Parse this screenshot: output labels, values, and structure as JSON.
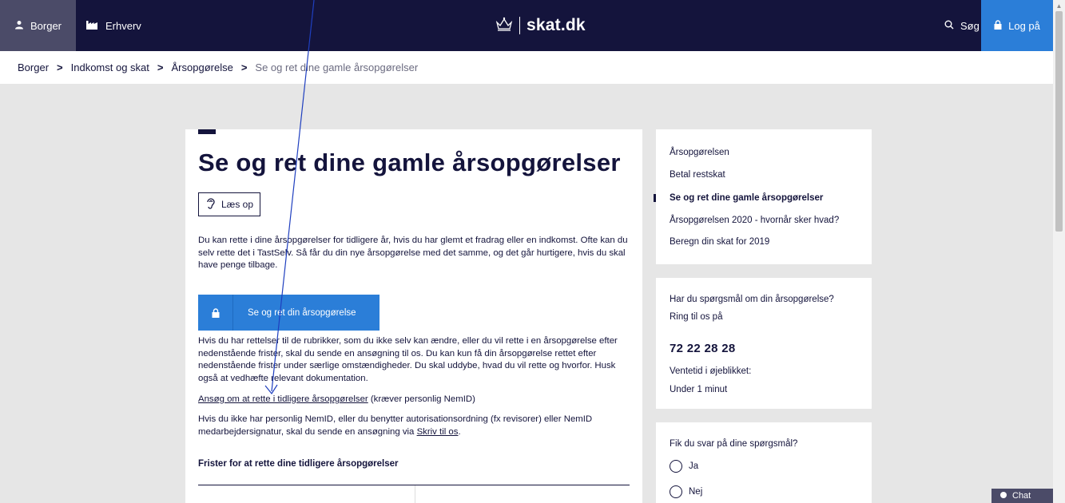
{
  "header": {
    "tab_borger": "Borger",
    "tab_erhverv": "Erhverv",
    "logo_text": "skat.dk",
    "search_label": "Søg",
    "login_label": "Log på",
    "colors": {
      "topbar": "#14143c",
      "active_tab": "#4b4b68",
      "login": "#2b7ed8"
    }
  },
  "breadcrumb": {
    "items": [
      "Borger",
      "Indkomst og skat",
      "Årsopgørelse"
    ],
    "current": "Se og ret dine gamle årsopgørelser",
    "separator": ">"
  },
  "main": {
    "title": "Se og ret dine gamle årsopgørelser",
    "read_aloud_label": "Læs op",
    "intro": "Du kan rette i dine årsopgørelser for tidligere år, hvis du har glemt et fradrag eller en indkomst. Ofte kan du selv rette det i TastSelv. Så får du din nye årsopgørelse med det samme, og det går hurtigere, hvis du skal have penge tilbage.",
    "cta_label": "Se og ret din årsopgørelse",
    "body": "Hvis du har rettelser til de rubrikker, som du ikke selv kan ændre, eller du vil rette i en årsopgørelse efter nedenstående frister, skal du sende en ansøgning til os. Du kan kun få din årsopgørelse rettet efter nedenstående frister under særlige omstændigheder. Du skal uddybe, hvad du vil rette og hvorfor. Husk også at vedhæfte relevant dokumentation.",
    "apply_link": "Ansøg om at rette i tidligere årsopgørelser",
    "apply_note": " (kræver personlig NemID)",
    "nemid_text": "Hvis du ikke har personlig NemID, eller du benytter autorisationsordning (fx revisorer) eller NemID medarbejdersignatur, skal du sende en ansøgning via ",
    "write_link": "Skriv til os",
    "write_suffix": ".",
    "deadlines_heading": "Frister for at rette dine tidligere årsopgørelser"
  },
  "sidebar_nav": {
    "items": [
      "Årsopgørelsen",
      "Betal restskat",
      "Se og ret dine gamle årsopgørelser",
      "Årsopgørelsen 2020 - hvornår sker hvad?",
      "Beregn din skat for 2019"
    ],
    "active_index": 2
  },
  "contact": {
    "question": "Har du spørgsmål om din årsopgørelse?",
    "call": "Ring til os på",
    "phone": "72 22 28 28",
    "wait_label": "Ventetid i øjeblikket:",
    "wait_value": "Under 1 minut"
  },
  "feedback": {
    "question": "Fik du svar på dine spørgsmål?",
    "options": [
      "Ja",
      "Nej"
    ]
  },
  "chat_label": "Chat"
}
